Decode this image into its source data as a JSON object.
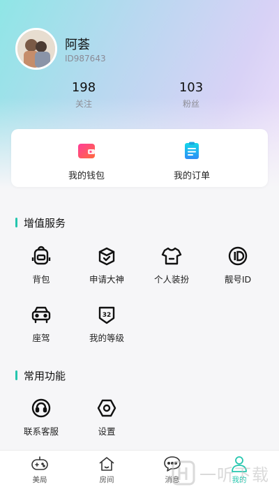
{
  "profile": {
    "nickname": "阿荟",
    "user_id": "ID987643"
  },
  "stats": [
    {
      "value": "198",
      "label": "关注"
    },
    {
      "value": "103",
      "label": "粉丝"
    }
  ],
  "quick_actions": [
    {
      "label": "我的钱包",
      "icon": "wallet-icon"
    },
    {
      "label": "我的订单",
      "icon": "order-list-icon"
    }
  ],
  "value_services": {
    "title": "增值服务",
    "items": [
      {
        "label": "背包",
        "icon": "backpack-icon"
      },
      {
        "label": "申请大神",
        "icon": "apply-master-icon"
      },
      {
        "label": "个人装扮",
        "icon": "tshirt-icon"
      },
      {
        "label": "靓号ID",
        "icon": "id-badge-icon"
      },
      {
        "label": "座驾",
        "icon": "car-icon"
      },
      {
        "label": "我的等级",
        "icon": "level-32-icon"
      }
    ],
    "level_badge": "32"
  },
  "common_functions": {
    "title": "常用功能",
    "items": [
      {
        "label": "联系客服",
        "icon": "headset-icon"
      },
      {
        "label": "设置",
        "icon": "settings-hex-icon"
      }
    ]
  },
  "tabbar": {
    "tabs": [
      {
        "label": "美局",
        "icon": "gamepad-icon",
        "active": false
      },
      {
        "label": "房间",
        "icon": "house-icon",
        "active": false
      },
      {
        "label": "消息",
        "icon": "chat-bubble-icon",
        "active": false
      },
      {
        "label": "我的",
        "icon": "user-icon",
        "active": true
      }
    ]
  },
  "watermark": {
    "text": "一听下载"
  },
  "colors": {
    "accent": "#25c6ae",
    "wallet_gradient": [
      "#ff3d9a",
      "#ff6a3d"
    ],
    "order_gradient": [
      "#14d8e8",
      "#2d8cf6"
    ]
  }
}
